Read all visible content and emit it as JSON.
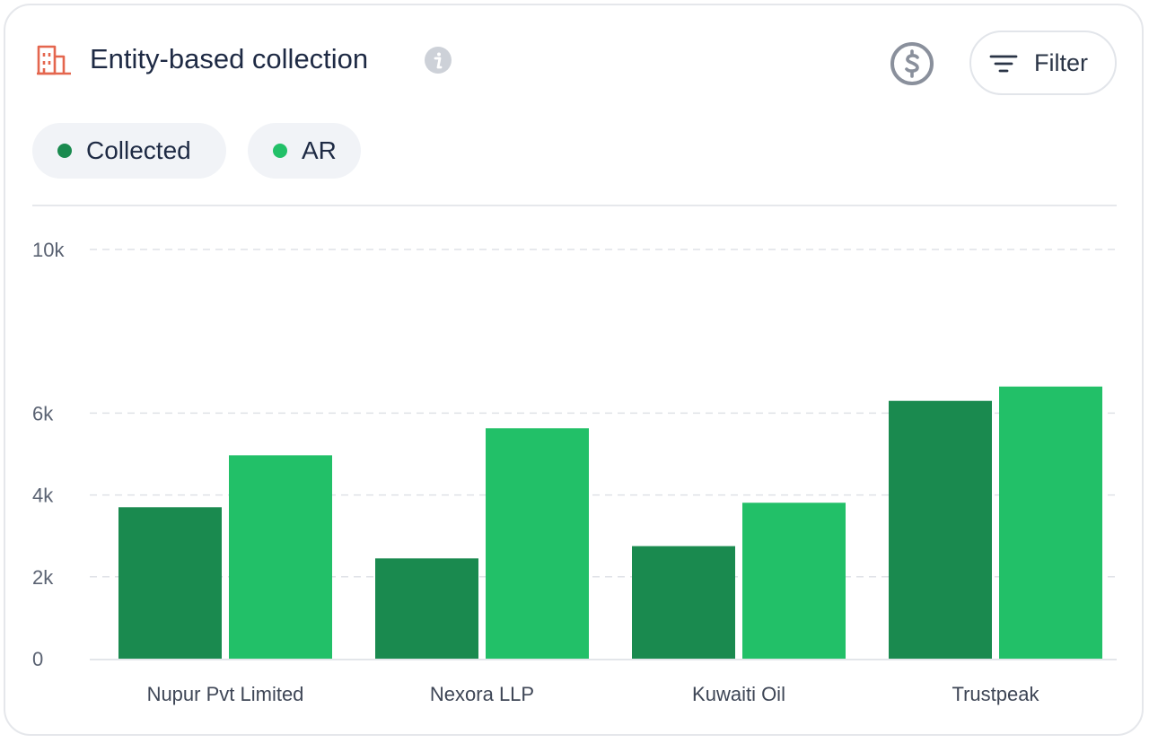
{
  "header": {
    "title": "Entity-based collection",
    "icons": {
      "entity": "building-icon",
      "info": "info-icon",
      "currency": "dollar-circle-icon",
      "filter": "filter-icon"
    },
    "accent_color": "#e4664e"
  },
  "filter": {
    "label": "Filter"
  },
  "legend": [
    {
      "label": "Collected",
      "color": "#1a8a4f"
    },
    {
      "label": "AR",
      "color": "#22c068"
    }
  ],
  "chart_data": {
    "type": "bar",
    "categories": [
      "Nupur Pvt Limited",
      "Nexora LLP",
      "Kuwaiti Oil",
      "Trustpeak"
    ],
    "series": [
      {
        "name": "Collected",
        "color": "#1a8a4f",
        "values": [
          3700,
          2450,
          2750,
          6300
        ]
      },
      {
        "name": "AR",
        "color": "#22c068",
        "values": [
          4970,
          5630,
          3810,
          6650
        ]
      }
    ],
    "ylim": [
      0,
      10500
    ],
    "yticks": [
      {
        "value": 0,
        "label": "0"
      },
      {
        "value": 2000,
        "label": "2k"
      },
      {
        "value": 4000,
        "label": "4k"
      },
      {
        "value": 6000,
        "label": "6k"
      },
      {
        "value": 10000,
        "label": "10k"
      }
    ],
    "grid": true,
    "legend_position": "top-left",
    "title": "",
    "xlabel": "",
    "ylabel": ""
  }
}
